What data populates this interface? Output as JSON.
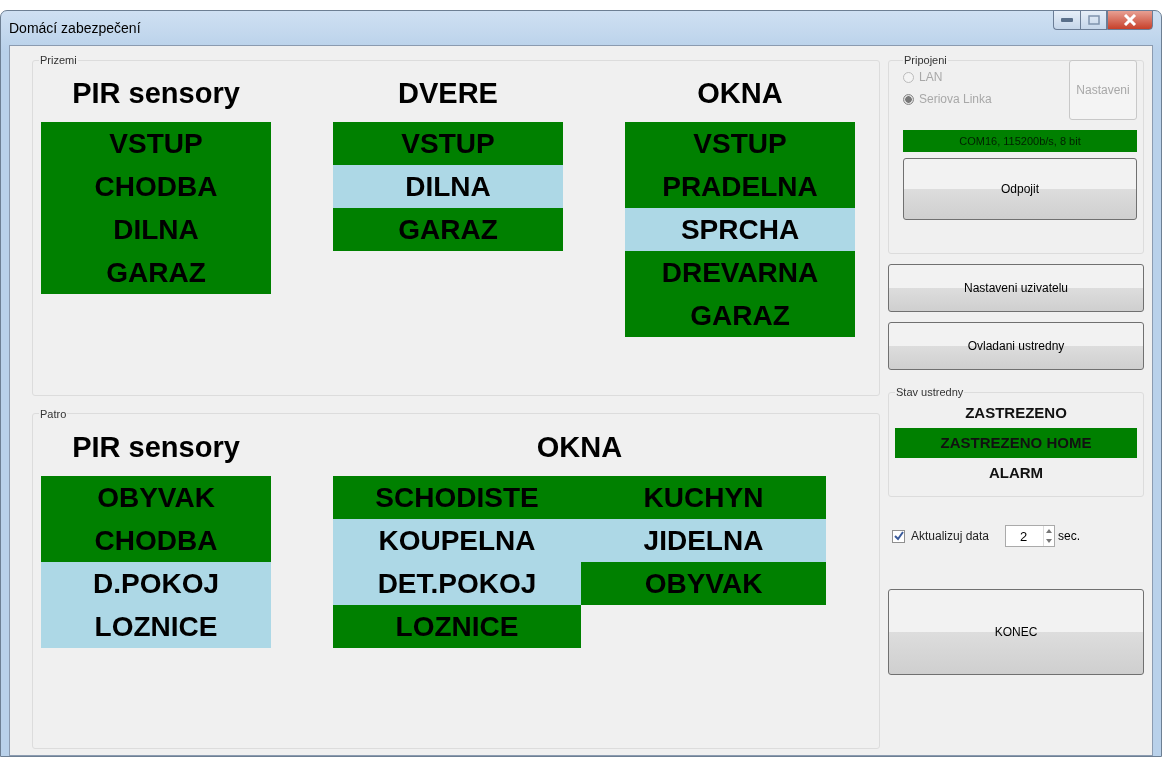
{
  "window": {
    "title": "Domácí zabezpečení"
  },
  "floors": [
    {
      "title": "Prizemi",
      "groups": [
        {
          "title": "PIR sensory",
          "kind": "single",
          "sensors": [
            {
              "name": "VSTUP",
              "color": "#008000"
            },
            {
              "name": "CHODBA",
              "color": "#008000"
            },
            {
              "name": "DILNA",
              "color": "#008000"
            },
            {
              "name": "GARAZ",
              "color": "#008000"
            }
          ]
        },
        {
          "title": "DVERE",
          "kind": "single",
          "sensors": [
            {
              "name": "VSTUP",
              "color": "#008000"
            },
            {
              "name": "DILNA",
              "color": "#add8e6"
            },
            {
              "name": "GARAZ",
              "color": "#008000"
            }
          ]
        },
        {
          "title": "OKNA",
          "kind": "single",
          "sensors": [
            {
              "name": "VSTUP",
              "color": "#008000"
            },
            {
              "name": "PRADELNA",
              "color": "#008000"
            },
            {
              "name": "SPRCHA",
              "color": "#add8e6"
            },
            {
              "name": "DREVARNA",
              "color": "#008000"
            },
            {
              "name": "GARAZ",
              "color": "#008000"
            }
          ]
        }
      ]
    },
    {
      "title": "Patro",
      "groups": [
        {
          "title": "PIR sensory",
          "kind": "single",
          "sensors": [
            {
              "name": "OBYVAK",
              "color": "#008000"
            },
            {
              "name": "CHODBA",
              "color": "#008000"
            },
            {
              "name": "D.POKOJ",
              "color": "#add8e6"
            },
            {
              "name": "LOZNICE",
              "color": "#add8e6"
            }
          ]
        },
        {
          "title": "OKNA",
          "kind": "double",
          "sensors": [
            {
              "name": "SCHODISTE",
              "color": "#008000"
            },
            {
              "name": "KUCHYN",
              "color": "#008000"
            },
            {
              "name": "KOUPELNA",
              "color": "#add8e6"
            },
            {
              "name": "JIDELNA",
              "color": "#add8e6"
            },
            {
              "name": "DET.POKOJ",
              "color": "#add8e6"
            },
            {
              "name": "OBYVAK",
              "color": "#008000"
            },
            {
              "name": "LOZNICE",
              "color": "#008000"
            }
          ]
        }
      ]
    }
  ],
  "connection": {
    "title": "Pripojeni",
    "options": [
      {
        "label": "LAN",
        "selected": false,
        "disabled": true
      },
      {
        "label": "Seriova Linka",
        "selected": true,
        "disabled": true
      }
    ],
    "settings_button": {
      "label": "Nastaveni",
      "disabled": true
    },
    "status": "COM16, 115200b/s, 8 bit",
    "disconnect_button": "Odpojit"
  },
  "buttons": [
    "Nastaveni uzivatelu",
    "Ovladani ustredny"
  ],
  "panel_state": {
    "title": "Stav ustredny",
    "states": [
      {
        "label": "ZASTREZENO",
        "selected": false
      },
      {
        "label": "ZASTREZENO HOME",
        "selected": true
      },
      {
        "label": "ALARM",
        "selected": false
      }
    ]
  },
  "refresh": {
    "label": "Aktualizuj data",
    "checked": true,
    "value": "2",
    "unit": "sec."
  },
  "exit_button": "KONEC"
}
